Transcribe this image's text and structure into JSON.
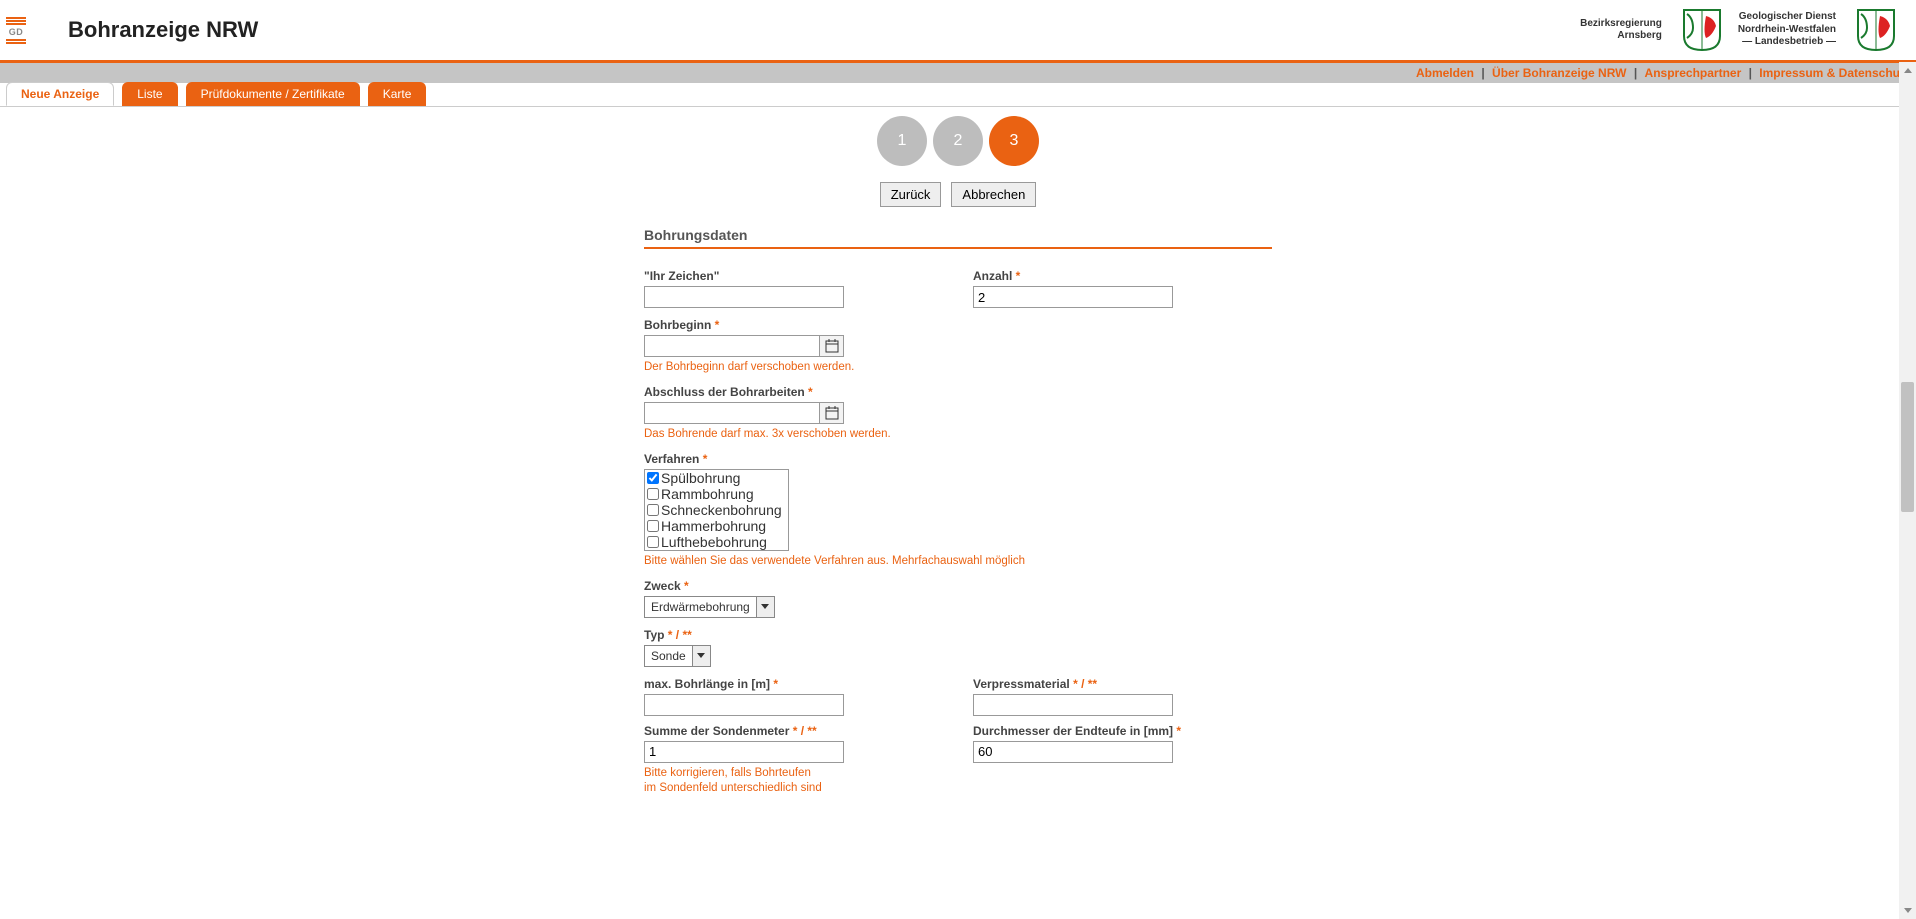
{
  "header": {
    "title": "Bohranzeige NRW",
    "org1_line1": "Bezirksregierung",
    "org1_line2": "Arnsberg",
    "org2_line1": "Geologischer Dienst",
    "org2_line2": "Nordrhein-Westfalen",
    "org2_line3": "— Landesbetrieb —"
  },
  "util": {
    "logout": "Abmelden",
    "about": "Über Bohranzeige NRW",
    "contact": "Ansprechpartner",
    "imprint": "Impressum & Datenschutz"
  },
  "tabs": {
    "new": "Neue Anzeige",
    "list": "Liste",
    "docs": "Prüfdokumente / Zertifikate",
    "map": "Karte"
  },
  "steps": {
    "s1": "1",
    "s2": "2",
    "s3": "3"
  },
  "buttons": {
    "back": "Zurück",
    "cancel": "Abbrechen"
  },
  "section": {
    "title": "Bohrungsdaten"
  },
  "form": {
    "zeichen_label": "\"Ihr Zeichen\"",
    "zeichen_value": "",
    "anzahl_label": "Anzahl",
    "anzahl_value": "2",
    "bohrbeginn_label": "Bohrbeginn",
    "bohrbeginn_value": "",
    "bohrbeginn_hint": "Der Bohrbeginn darf verschoben werden.",
    "abschluss_label": "Abschluss der Bohrarbeiten",
    "abschluss_value": "",
    "abschluss_hint": "Das Bohrende darf max. 3x verschoben werden.",
    "verfahren_label": "Verfahren",
    "verfahren_hint": "Bitte wählen Sie das verwendete Verfahren aus. Mehrfachauswahl möglich",
    "verfahren_options": [
      {
        "label": "Spülbohrung",
        "checked": true
      },
      {
        "label": "Rammbohrung",
        "checked": false
      },
      {
        "label": "Schneckenbohrung",
        "checked": false
      },
      {
        "label": "Hammerbohrung",
        "checked": false
      },
      {
        "label": "Lufthebebohrung",
        "checked": false
      }
    ],
    "zweck_label": "Zweck",
    "zweck_value": "Erdwärmebohrung",
    "typ_label": "Typ",
    "typ_value": "Sonde",
    "bohrlaenge_label": "max. Bohrlänge in [m]",
    "bohrlaenge_value": "",
    "verpress_label": "Verpressmaterial",
    "verpress_value": "",
    "sondenmeter_label": "Summe der Sondenmeter",
    "sondenmeter_value": "1",
    "sondenmeter_hint": "Bitte korrigieren, falls Bohrteufen im Sondenfeld unterschiedlich sind",
    "durchmesser_label": "Durchmesser der Endteufe in [mm]",
    "durchmesser_value": "60",
    "req_marker": " *",
    "req_marker2": " * / **"
  }
}
